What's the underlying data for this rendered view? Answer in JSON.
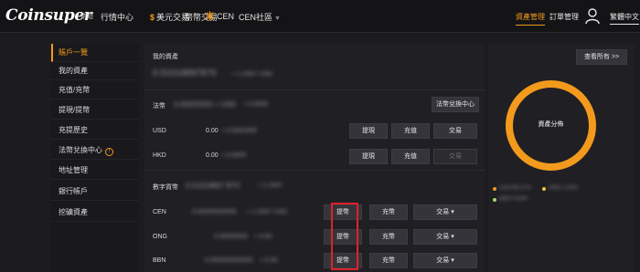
{
  "header": {
    "logo": "Coinsuper",
    "logo_sub": "幣超",
    "nav": [
      "行情中心",
      "美元交易",
      "幣幣交易",
      "CEN",
      "CEN社區"
    ],
    "right_nav": [
      "資產管理",
      "訂單管理",
      "繁體中文"
    ]
  },
  "sidebar": {
    "items": [
      "賬戶一覽",
      "我的資產",
      "充值/充幣",
      "提現/提幣",
      "充提歷史",
      "法幣兌換中心",
      "地址管理",
      "銀行帳戶",
      "挖礦資產"
    ]
  },
  "assets": {
    "title": "我的資產",
    "total": "0.51018897870",
    "total_unit": "≈ 1.2547 USD",
    "view_all_button": "查看所有 >>"
  },
  "fiat": {
    "label": "法幣",
    "total": "0.00025555 ≈ USD",
    "total_sub": "≈ 0.0000",
    "exchange_center_button": "法幣兌換中心",
    "rows": [
      {
        "currency": "USD",
        "amount": "0.00",
        "approx": "≈ 0.0002655",
        "withdraw": "提現",
        "deposit": "充值",
        "trade": "交易"
      },
      {
        "currency": "HKD",
        "amount": "0.00",
        "approx": "≈ 0.0000",
        "withdraw": "提現",
        "deposit": "充值",
        "trade": "交易"
      }
    ]
  },
  "digital": {
    "label": "數字貨幣",
    "total": "0.51018897 BTC",
    "total_sub": "≈ 1.2547",
    "rows": [
      {
        "currency": "CEN",
        "amount": "0.00000000000",
        "approx": "≈ 1.2547 USD",
        "withdraw": "提幣",
        "deposit": "充幣",
        "trade": "交易"
      },
      {
        "currency": "ONG",
        "amount": "0.00000000",
        "approx": "≈ 0.00",
        "withdraw": "提幣",
        "deposit": "充幣",
        "trade": "交易"
      },
      {
        "currency": "BBN",
        "amount": "0.000000000000",
        "approx": "≈ 0.00",
        "withdraw": "提幣",
        "deposit": "充幣",
        "trade": "交易"
      }
    ]
  },
  "distribution": {
    "label": "資產分佈",
    "legend": [
      "CEN 98.37%",
      "ONG 1.00%",
      "BBN 0.63%"
    ],
    "colors": {
      "accent": "#f39a1d",
      "legend1": "#f39a1d",
      "legend2": "#f7c142",
      "legend3": "#a7d96b"
    }
  }
}
